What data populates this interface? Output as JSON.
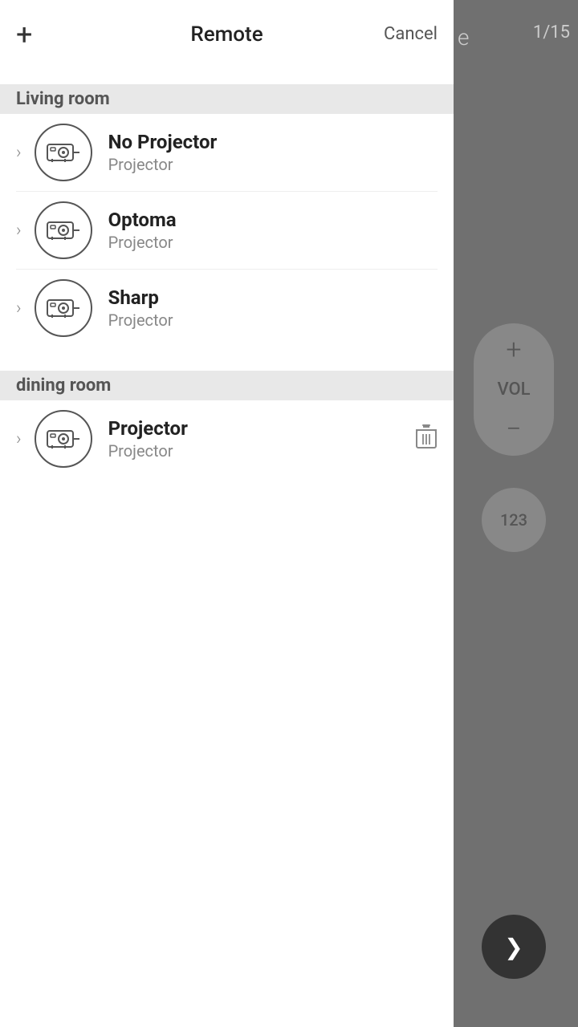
{
  "header": {
    "title": "Remote",
    "add_label": "+",
    "cancel_label": "Cancel"
  },
  "right_panel": {
    "title_letter": "e",
    "page": "1/15",
    "vol_plus": "+",
    "vol_label": "VOL",
    "vol_minus": "−",
    "btn_123": "123",
    "btn_next_icon": "❯"
  },
  "sections": [
    {
      "label": "Living room",
      "devices": [
        {
          "name": "No Projector",
          "type": "Projector",
          "has_trash": false
        },
        {
          "name": "Optoma",
          "type": "Projector",
          "has_trash": false
        },
        {
          "name": "Sharp",
          "type": "Projector",
          "has_trash": false
        }
      ]
    },
    {
      "label": "dining room",
      "devices": [
        {
          "name": "Projector",
          "type": "Projector",
          "has_trash": true
        }
      ]
    }
  ]
}
